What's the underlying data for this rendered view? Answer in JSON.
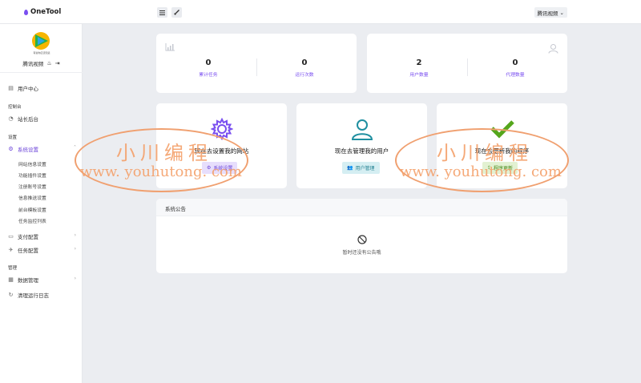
{
  "app": {
    "brand": "OneTool"
  },
  "topbar": {
    "menu_icon": "menu-icon",
    "brush_icon": "brush-icon",
    "user": "腾讯视频",
    "caret": "⌄"
  },
  "sidebar": {
    "site_name": "腾讯视频",
    "logo_caption": "有些你应该知道",
    "items": [
      {
        "label": "用户中心"
      },
      {
        "section": "控制台"
      },
      {
        "label": "站长后台"
      },
      {
        "section": "设置"
      },
      {
        "label": "系统设置"
      },
      {
        "label": "支付配置"
      },
      {
        "label": "任务配置"
      },
      {
        "section": "管理"
      },
      {
        "label": "数据管理"
      },
      {
        "label": "清理运行日志"
      }
    ],
    "sub_items": [
      "网站信息设置",
      "功能插件设置",
      "注册账号设置",
      "信息推送设置",
      "前台模板设置",
      "任务监控列表"
    ]
  },
  "stats_left": [
    {
      "value": "0",
      "label": "累计任务"
    },
    {
      "value": "0",
      "label": "运行次数"
    }
  ],
  "stats_right": [
    {
      "value": "2",
      "label": "用户数量"
    },
    {
      "value": "0",
      "label": "代理数量"
    }
  ],
  "actions": [
    {
      "title": "现在去设置我的网站",
      "button": "系统设置"
    },
    {
      "title": "现在去管理我的用户",
      "button": "用户管理"
    },
    {
      "title": "现在去更新我的程序",
      "button": "程序更新"
    }
  ],
  "notice": {
    "title": "系统公告",
    "empty": "暂时还没有公告哦"
  },
  "watermark": {
    "cn": "小川编程",
    "url": "www. youhutong. com"
  },
  "colors": {
    "accent": "#7a4ff0",
    "teal": "#1f8fa0",
    "green": "#55a61c",
    "watermark": "#f4a06a"
  }
}
